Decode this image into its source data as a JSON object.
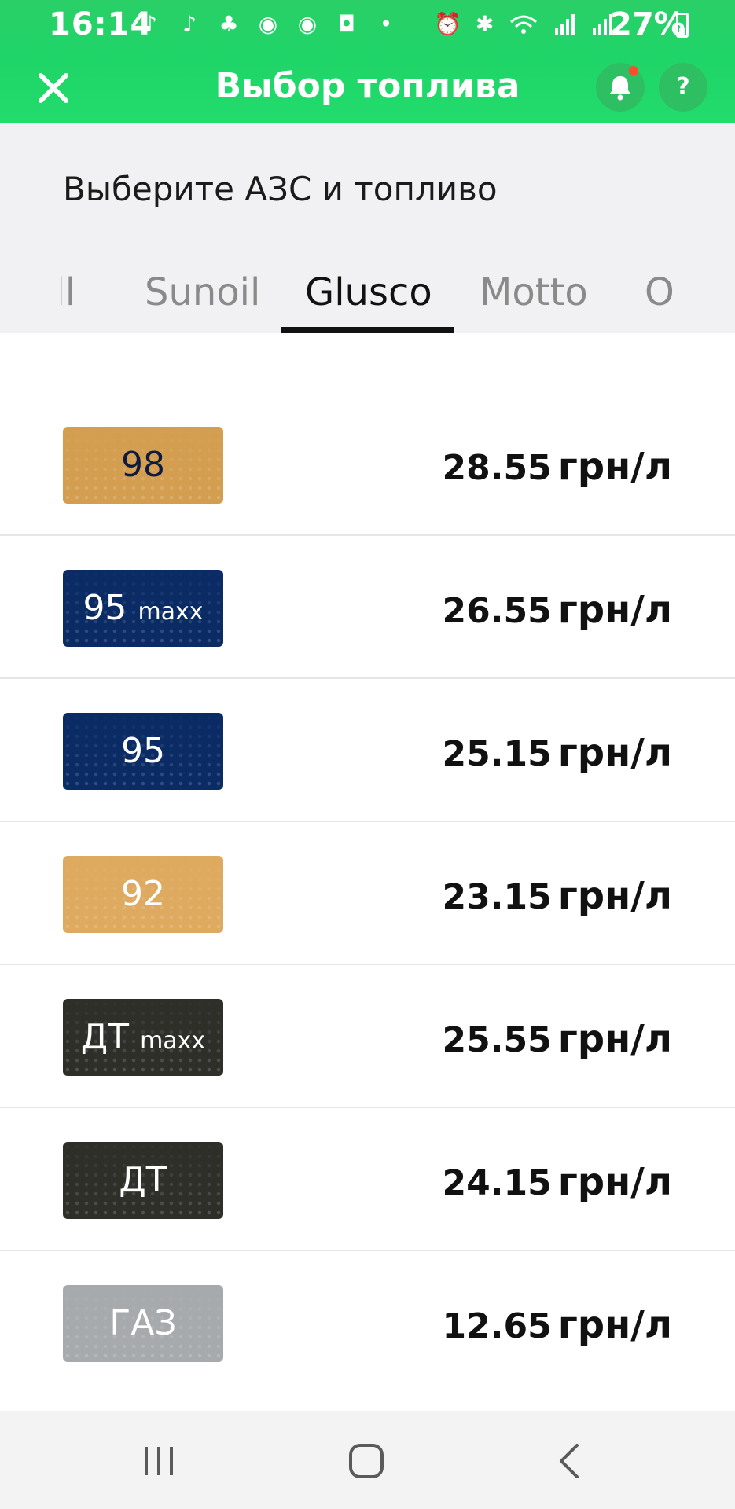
{
  "status_bar": {
    "time": "16:14",
    "battery": "27%",
    "icons_left": [
      "tiktok-icon",
      "tiktok-icon",
      "app-icon",
      "chrome-icon",
      "chrome-icon",
      "instagram-icon",
      "dot-icon"
    ],
    "icons_right": [
      "alarm-icon",
      "bluetooth-icon",
      "wifi-icon",
      "signal-icon",
      "signal-icon"
    ]
  },
  "header": {
    "title": "Выбор топлива",
    "close_icon": "close-icon",
    "bell_icon": "bell-icon",
    "help_label": "?",
    "brand_color": "#22d36a"
  },
  "selection": {
    "subtitle": "Выберите АЗС и топливо",
    "tabs": [
      {
        "label": "ell",
        "active": false
      },
      {
        "label": "Sunoil",
        "active": false
      },
      {
        "label": "Glusco",
        "active": true
      },
      {
        "label": "Motto",
        "active": false
      },
      {
        "label": "O",
        "active": false
      }
    ]
  },
  "fuels": [
    {
      "name": "98",
      "suffix": "",
      "price": "28.55",
      "unit": "грн/л",
      "style": "gold"
    },
    {
      "name": "95",
      "suffix": "maxx",
      "price": "26.55",
      "unit": "грн/л",
      "style": "navy"
    },
    {
      "name": "95",
      "suffix": "",
      "price": "25.15",
      "unit": "грн/л",
      "style": "navy"
    },
    {
      "name": "92",
      "suffix": "",
      "price": "23.15",
      "unit": "грн/л",
      "style": "gold2"
    },
    {
      "name": "ДТ",
      "suffix": "maxx",
      "price": "25.55",
      "unit": "грн/л",
      "style": "dark"
    },
    {
      "name": "ДТ",
      "suffix": "",
      "price": "24.15",
      "unit": "грн/л",
      "style": "dark"
    },
    {
      "name": "ГАЗ",
      "suffix": "",
      "price": "12.65",
      "unit": "грн/л",
      "style": "gray"
    }
  ],
  "nav_bar": {
    "buttons": [
      "recent-apps-icon",
      "home-icon",
      "back-icon"
    ]
  }
}
